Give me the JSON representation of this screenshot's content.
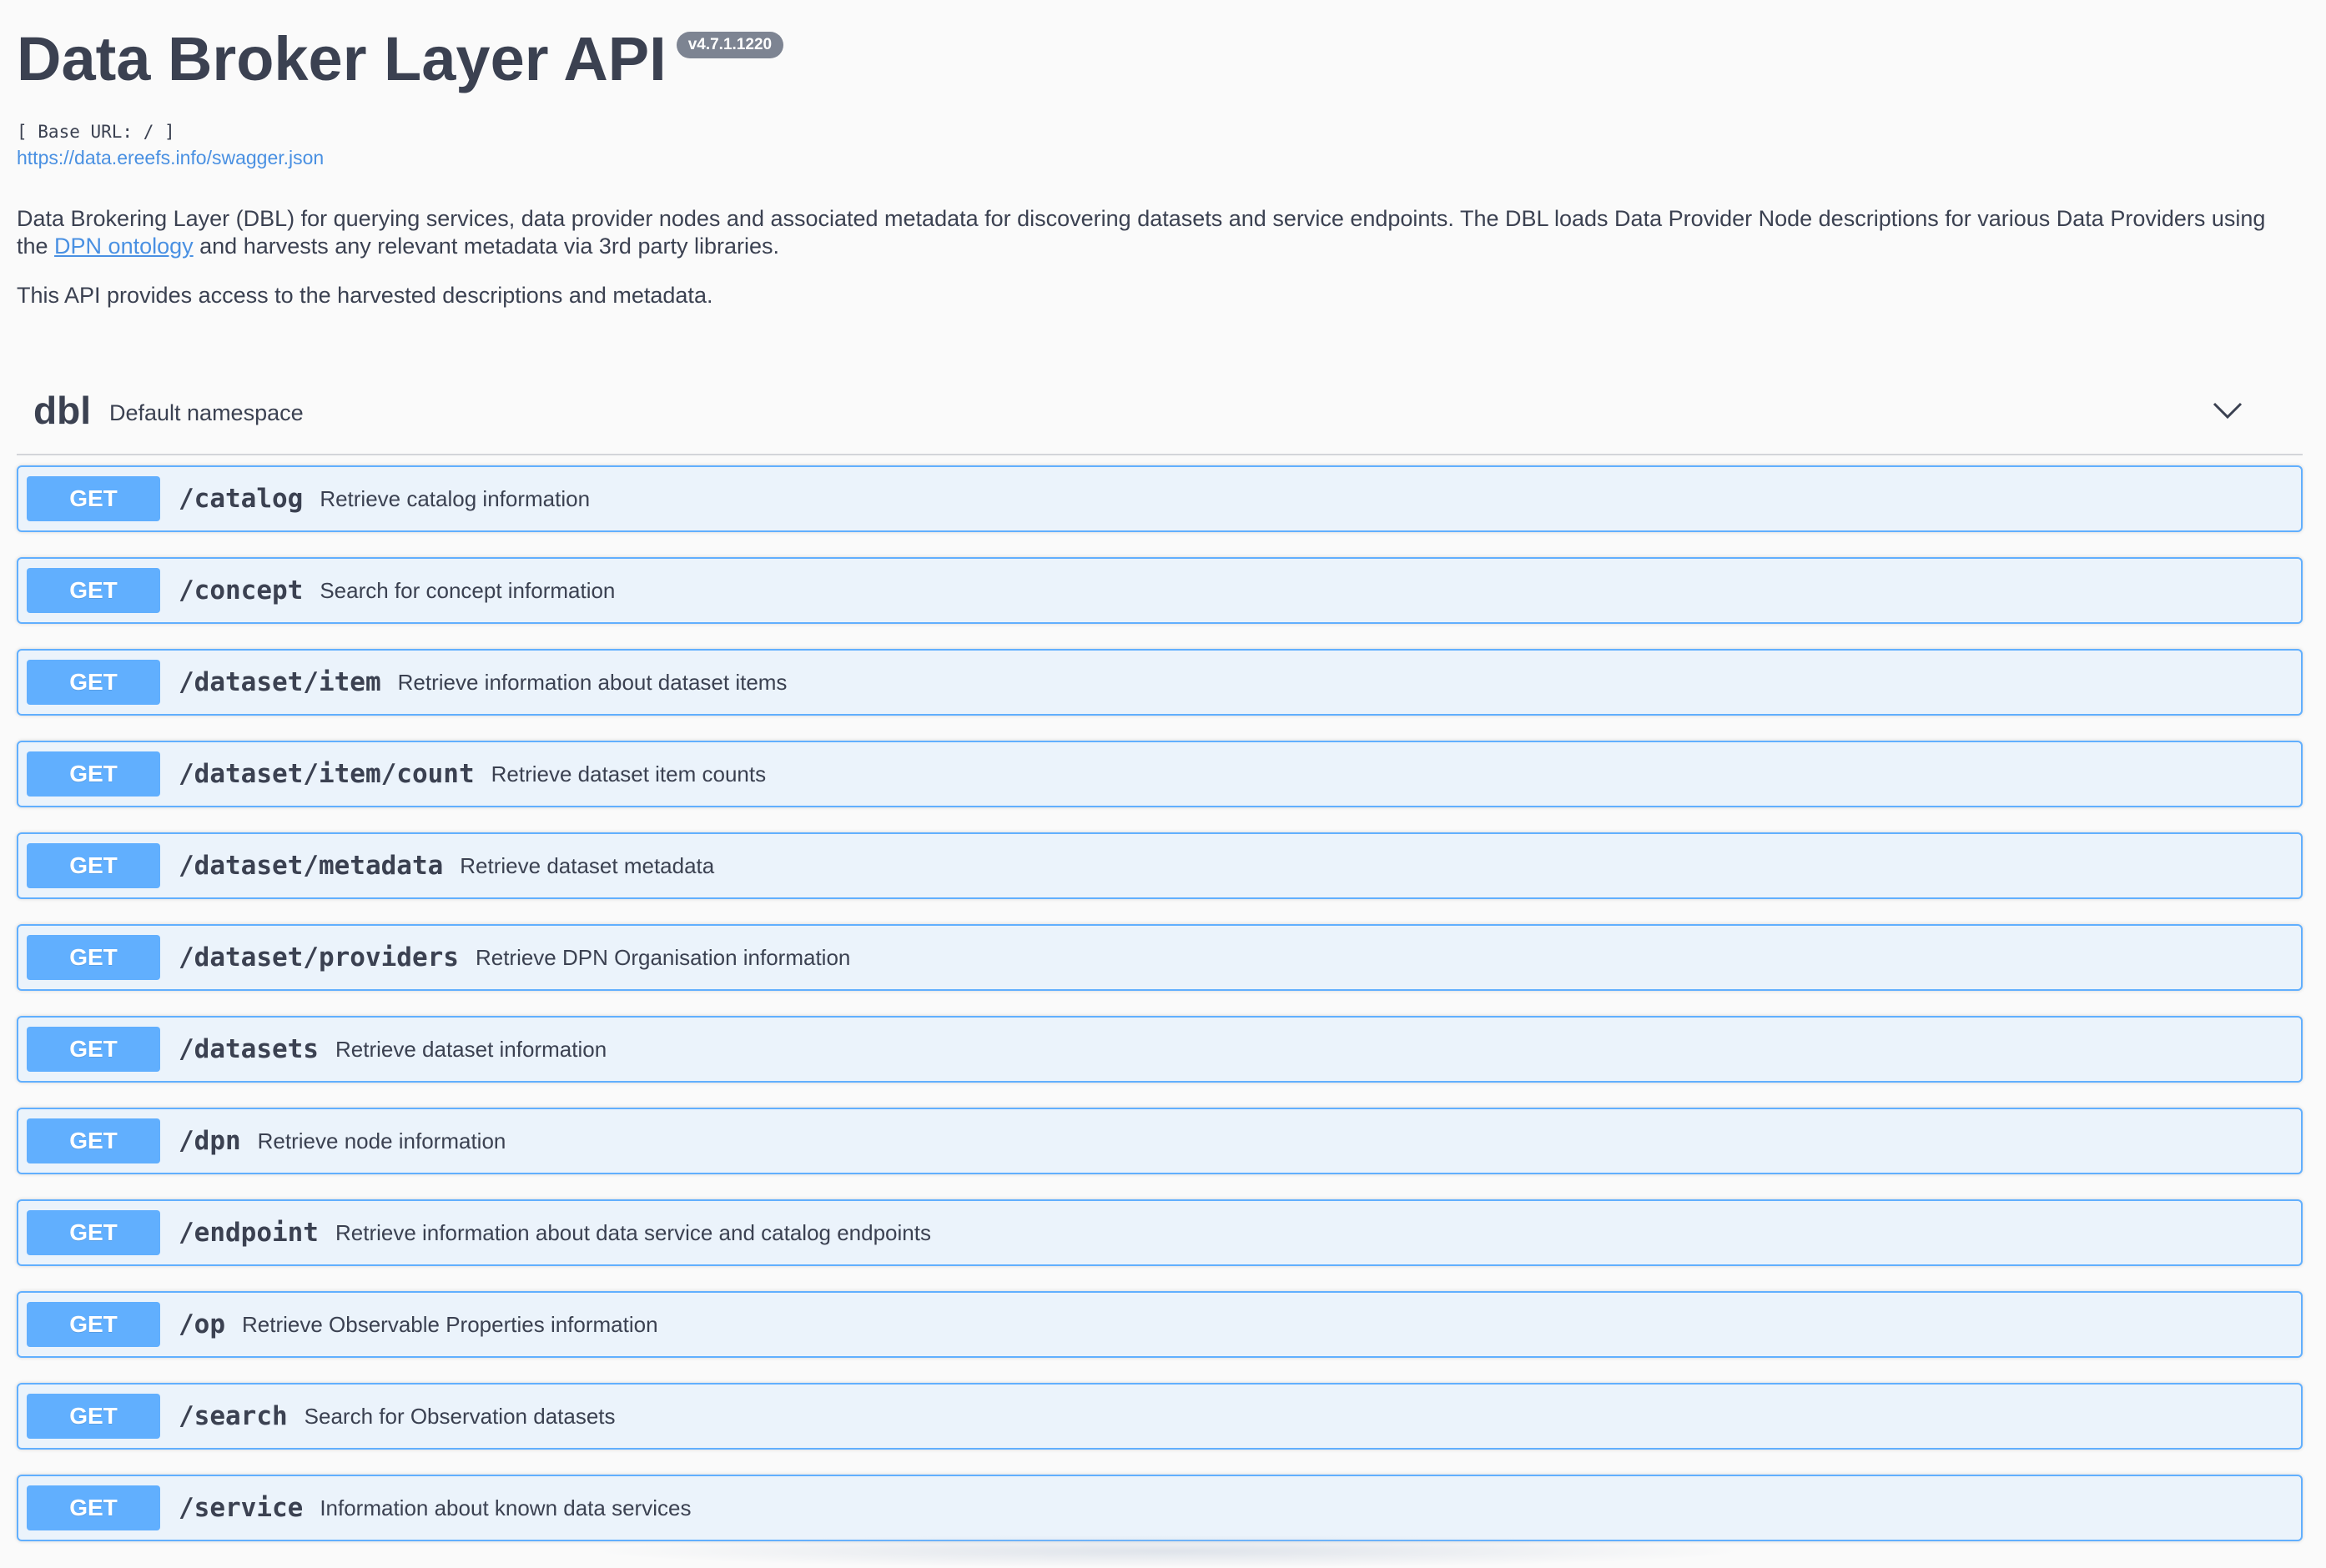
{
  "info": {
    "title": "Data Broker Layer API",
    "version": "v4.7.1.1220",
    "base_url": "[ Base URL: / ]",
    "spec_link": "https://data.ereefs.info/swagger.json",
    "description_p1_before_link": "Data Brokering Layer (DBL) for querying services, data provider nodes and associated metadata for discovering datasets and service endpoints. The DBL loads Data Provider Node descriptions for various Data Providers using the ",
    "description_link": "DPN ontology",
    "description_p1_after_link": " and harvests any relevant metadata via 3rd party libraries.",
    "description_p2": "This API provides access to the harvested descriptions and metadata."
  },
  "namespace": {
    "name": "dbl",
    "description": "Default namespace",
    "toggle_icon": "chevron-down-icon"
  },
  "operations": [
    {
      "method": "GET",
      "path": "/catalog",
      "summary": "Retrieve catalog information"
    },
    {
      "method": "GET",
      "path": "/concept",
      "summary": "Search for concept information"
    },
    {
      "method": "GET",
      "path": "/dataset/item",
      "summary": "Retrieve information about dataset items"
    },
    {
      "method": "GET",
      "path": "/dataset/item/count",
      "summary": "Retrieve dataset item counts"
    },
    {
      "method": "GET",
      "path": "/dataset/metadata",
      "summary": "Retrieve dataset metadata"
    },
    {
      "method": "GET",
      "path": "/dataset/providers",
      "summary": "Retrieve DPN Organisation information"
    },
    {
      "method": "GET",
      "path": "/datasets",
      "summary": "Retrieve dataset information"
    },
    {
      "method": "GET",
      "path": "/dpn",
      "summary": "Retrieve node information"
    },
    {
      "method": "GET",
      "path": "/endpoint",
      "summary": "Retrieve information about data service and catalog endpoints"
    },
    {
      "method": "GET",
      "path": "/op",
      "summary": "Retrieve Observable Properties information"
    },
    {
      "method": "GET",
      "path": "/search",
      "summary": "Search for Observation datasets"
    },
    {
      "method": "GET",
      "path": "/service",
      "summary": "Information about known data services"
    }
  ],
  "colors": {
    "get_accent": "#61affe",
    "get_background": "#ebf3fb",
    "text": "#3b4151",
    "link": "#4990e2",
    "version_badge": "#7d8492"
  }
}
